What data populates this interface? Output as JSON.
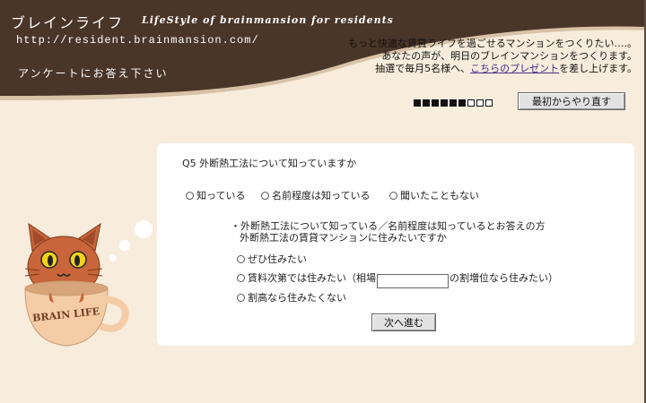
{
  "header": {
    "site_name": "ブレインライフ",
    "tagline": "LifeStyle of brainmansion for residents",
    "url": "http://resident.brainmansion.com/",
    "page_heading": "アンケートにお答え下さい",
    "intro_line1": "もっと快適な賃貸ライフを過ごせるマンションをつくりたい….。",
    "intro_line2": "あなたの声が、明日のブレインマンションをつくります。",
    "intro_line3_prefix": "抽選で毎月5名様へ、",
    "intro_link": "こちらのプレゼント",
    "intro_line3_suffix": "を差し上げます。"
  },
  "progress": {
    "completed": 6,
    "total": 9
  },
  "restart_button": "最初からやり直す",
  "survey": {
    "question": "Q5  外断熱工法について知っていますか",
    "options": [
      "知っている",
      "名前程度は知っている",
      "聞いたこともない"
    ],
    "followup_line1": "・外断熱工法について知っている／名前程度は知っているとお答えの方",
    "followup_line2": "外断熱工法の賃貸マンションに住みたいですか",
    "followup_option1": "ぜひ住みたい",
    "followup_option2_prefix": "賃料次第では住みたい（相場",
    "followup_option2_value": "",
    "followup_option2_suffix": "の割増位なら住みたい）",
    "followup_option3": "割高なら住みたくない",
    "next_button": "次へ進む"
  },
  "mascot": {
    "cup_text": "BRAIN LIFE"
  },
  "colors": {
    "header_brown": "#4a3529",
    "background": "#f8ecdc",
    "panel": "#ffffff",
    "cat": "#c8653a",
    "cup": "#f4cda7"
  }
}
